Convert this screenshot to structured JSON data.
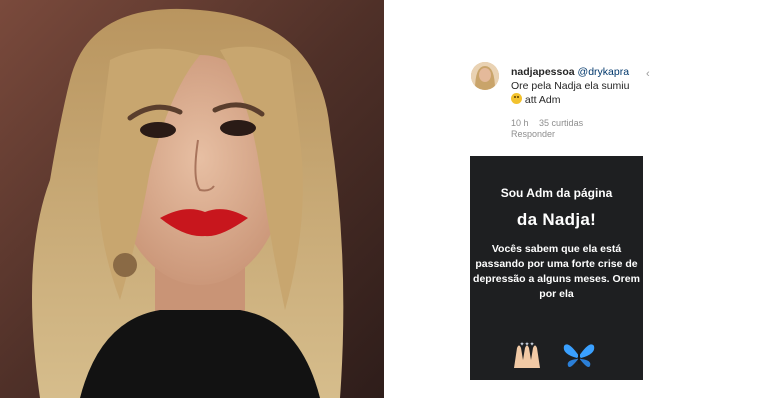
{
  "photo": {
    "description_icon": "woman-portrait-photo"
  },
  "comment": {
    "username": "nadjapessoa",
    "mention": "@drykapra",
    "text_before_emoji": "Ore pela Nadja ela sumiu",
    "text_after_emoji": "att Adm",
    "time": "10 h",
    "likes": "35 curtidas",
    "reply": "Responder",
    "more_icon": "chevron-left-icon"
  },
  "story": {
    "line1": "Sou Adm da página",
    "line2": "da Nadja!",
    "body": "Vocês sabem que ela está passando por uma forte crise de depressão a alguns meses. Orem por ela",
    "icons": [
      "praying-hands-emoji",
      "blue-butterfly-emoji"
    ]
  },
  "colors": {
    "story_bg": "#1e1f21",
    "text_dark": "#262626",
    "meta_gray": "#8e8e8e",
    "butterfly_blue": "#3aa0ff"
  }
}
